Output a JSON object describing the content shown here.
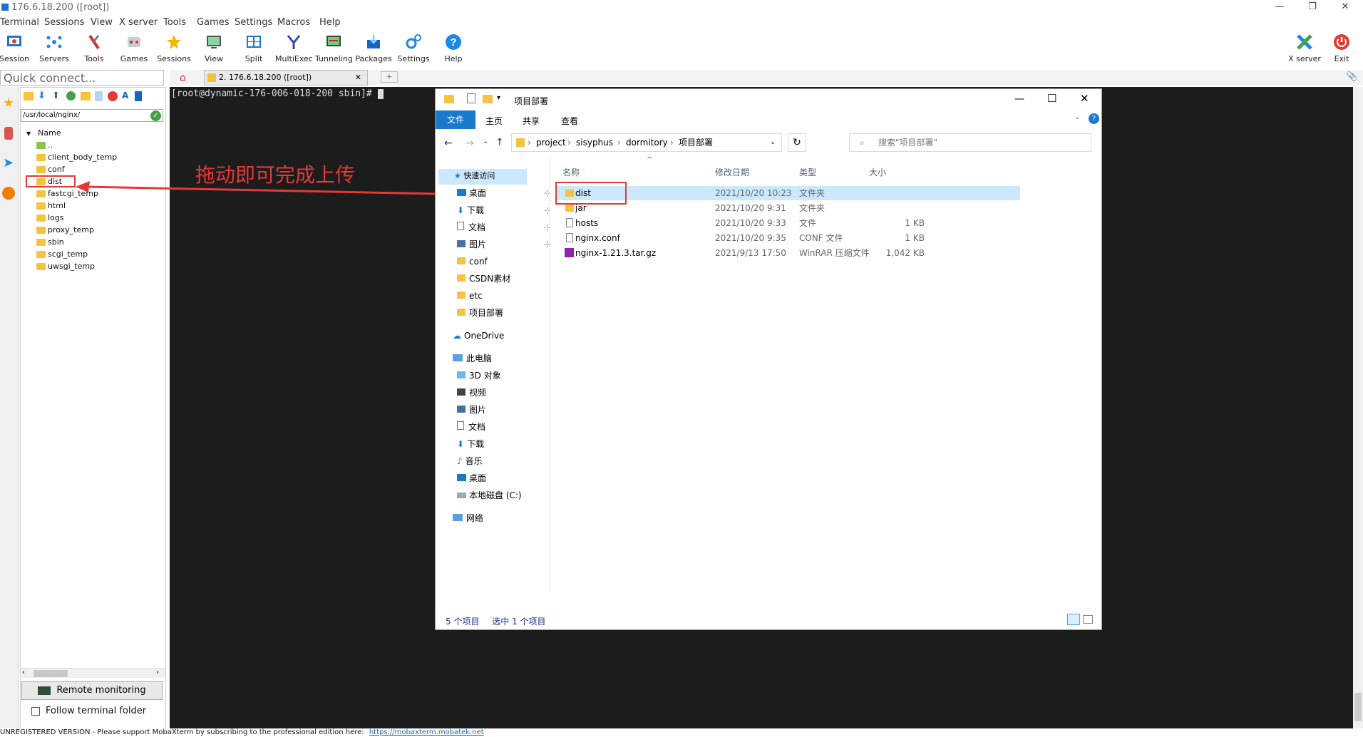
{
  "window": {
    "title": "176.6.18.200 ([root])"
  },
  "menu": [
    "Terminal",
    "Sessions",
    "View",
    "X server",
    "Tools",
    "Games",
    "Settings",
    "Macros",
    "Help"
  ],
  "toolbar": [
    {
      "label": "Session",
      "icon": "session-icon",
      "color": "#2a6ed8"
    },
    {
      "label": "Servers",
      "icon": "servers-icon",
      "color": "#1e88e5"
    },
    {
      "label": "Tools",
      "icon": "tools-icon",
      "color": "#d32f2f"
    },
    {
      "label": "Games",
      "icon": "games-icon",
      "color": "#555555"
    },
    {
      "label": "Sessions",
      "icon": "star-icon",
      "color": "#f4b400"
    },
    {
      "label": "View",
      "icon": "view-icon",
      "color": "#2e7d32"
    },
    {
      "label": "Split",
      "icon": "split-icon",
      "color": "#1976d2"
    },
    {
      "label": "MultiExec",
      "icon": "multiexec-icon",
      "color": "#3949ab"
    },
    {
      "label": "Tunneling",
      "icon": "tunneling-icon",
      "color": "#388e3c"
    },
    {
      "label": "Packages",
      "icon": "packages-icon",
      "color": "#1565c0"
    },
    {
      "label": "Settings",
      "icon": "settings-icon",
      "color": "#1e88e5"
    },
    {
      "label": "Help",
      "icon": "help-icon",
      "color": "#1e88e5"
    }
  ],
  "toolbar_right": [
    {
      "label": "X server",
      "icon": "x-server-icon"
    },
    {
      "label": "Exit",
      "icon": "exit-icon"
    }
  ],
  "quick_connect": {
    "placeholder": "Quick connect..."
  },
  "tabs": [
    {
      "label": "2. 176.6.18.200 ([root])"
    }
  ],
  "sftp": {
    "path": "/usr/local/nginx/",
    "column": "Name",
    "items": [
      "..",
      "client_body_temp",
      "conf",
      "dist",
      "fastcgi_temp",
      "html",
      "logs",
      "proxy_temp",
      "sbin",
      "scgi_temp",
      "uwsgi_temp"
    ],
    "remote_monitoring": "Remote monitoring",
    "follow_folder": "Follow terminal folder"
  },
  "terminal": {
    "prompt": "[root@dynamic-176-006-018-200 sbin]#"
  },
  "annotation": {
    "text": "拖动即可完成上传",
    "color": "#e53935"
  },
  "status_bar": {
    "text": "UNREGISTERED VERSION  -  Please support MobaXterm by subscribing to the professional edition here:",
    "link": "https://mobaxterm.mobatek.net"
  },
  "explorer": {
    "title": "项目部署",
    "ribbon_tabs": [
      "文件",
      "主页",
      "共享",
      "查看"
    ],
    "breadcrumb": [
      "project",
      "sisyphus",
      "dormitory",
      "项目部署"
    ],
    "search_placeholder": "搜索\"项目部署\"",
    "nav": [
      "快速访问",
      "桌面",
      "下载",
      "文档",
      "图片",
      "conf",
      "CSDN素材",
      "etc",
      "项目部署",
      "OneDrive",
      "此电脑",
      "3D 对象",
      "视频",
      "图片",
      "文档",
      "下载",
      "音乐",
      "桌面",
      "本地磁盘 (C:)",
      "网络"
    ],
    "columns": [
      "名称",
      "修改日期",
      "类型",
      "大小"
    ],
    "files": [
      {
        "name": "dist",
        "date": "2021/10/20 10:23",
        "type": "文件夹",
        "size": ""
      },
      {
        "name": "jar",
        "date": "2021/10/20 9:31",
        "type": "文件夹",
        "size": ""
      },
      {
        "name": "hosts",
        "date": "2021/10/20 9:33",
        "type": "文件",
        "size": "1 KB"
      },
      {
        "name": "nginx.conf",
        "date": "2021/10/20 9:35",
        "type": "CONF 文件",
        "size": "1 KB"
      },
      {
        "name": "nginx-1.21.3.tar.gz",
        "date": "2021/9/13 17:50",
        "type": "WinRAR 压缩文件",
        "size": "1,042 KB"
      }
    ],
    "status_items": "5 个项目",
    "status_selected": "选中 1 个项目"
  }
}
